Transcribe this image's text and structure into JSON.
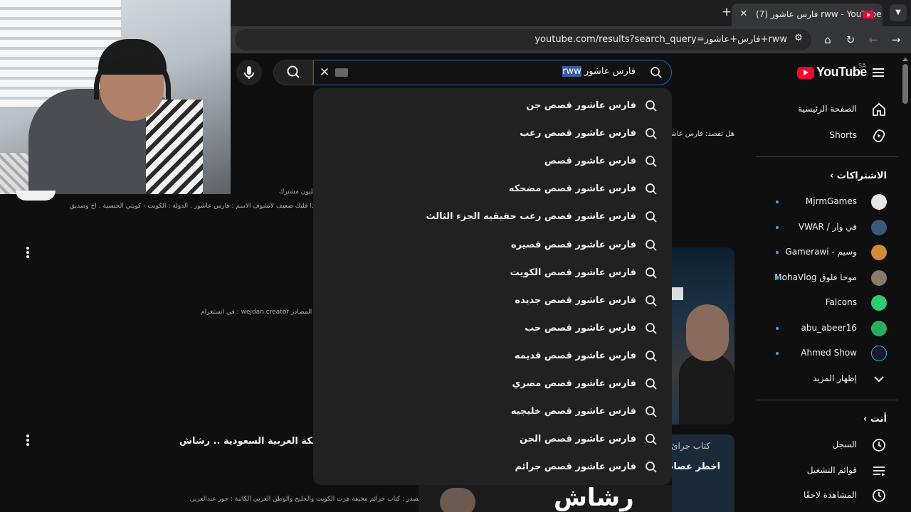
{
  "browser": {
    "tab_title": "(7) فارس عاشور rww - YouTube",
    "tab_close": "✕",
    "new_tab": "+",
    "url": "youtube.com/results?search_query=فارس+عاشور+rww"
  },
  "header": {
    "logo_text": "YouTube",
    "country_code": "SA",
    "search_query_ar": "فارس عاشور",
    "search_query_sel": "rww"
  },
  "suggestions": [
    "فارس عاشور قصص جن",
    "فارس عاشور قصص رعب",
    "فارس عاشور قصص",
    "فارس عاشور قصص مضحكه",
    "فارس عاشور قصص رعب حقيقيه الجزء الثالث",
    "فارس عاشور قصص قصيره",
    "فارس عاشور قصص الكويت",
    "فارس عاشور قصص جديده",
    "فارس عاشور قصص حب",
    "فارس عاشور قصص قديمه",
    "فارس عاشور قصص مصري",
    "فارس عاشور قصص خليجيه",
    "فارس عاشور قصص الجن",
    "فارس عاشور قصص جرائم"
  ],
  "sidebar": {
    "home": "الصفحة الرئيسية",
    "shorts": "Shorts",
    "subscriptions_header": "الاشتراكات",
    "subscriptions": [
      {
        "name": "MjrmGames",
        "color": "#e6e6e6"
      },
      {
        "name": "في وار / VWAR",
        "color": "#3a5a7a"
      },
      {
        "name": "وسيم - Gamerawi",
        "color": "#d08a3a"
      },
      {
        "name": "موحا فلوق MohaVlog",
        "color": "#8a7a6a"
      },
      {
        "name": "Falcons",
        "color": "#2ecc71"
      },
      {
        "name": "abu_abeer16",
        "color": "#27ae60"
      },
      {
        "name": "Ahmed Show",
        "color": "#1a1a2a"
      }
    ],
    "show_more": "إظهار المزيد",
    "you_header": "أنت",
    "history": "السجل",
    "playlists": "قوائم التشغيل",
    "watch_later": "المشاهدة لاحقًا"
  },
  "results": {
    "did_you_mean": "هل تقصد: فارس عاشور",
    "channel_subs": "مليون مشترك",
    "channel_desc": "... إذا قلبك ضعيف لاتشوف الاسم : فارس عاشور . الدولة : الكويت - كويتي الجنسية . اخ وصديق",
    "channel_src": "المصادر wejdan.creator : في انستغرام",
    "video_title": "في المملكة العربية السعودية .. رشاش",
    "video_desc": "المصدر : كتاب جرائم مخيفة هزت الكويت والخليج والوطن العربي الكاتبة : حور عبدالعزيز.",
    "thumb2_line1": "كتاب جرائ",
    "thumb2_line2": "اخطر عصاب",
    "thumb3_text": "رشاش"
  }
}
